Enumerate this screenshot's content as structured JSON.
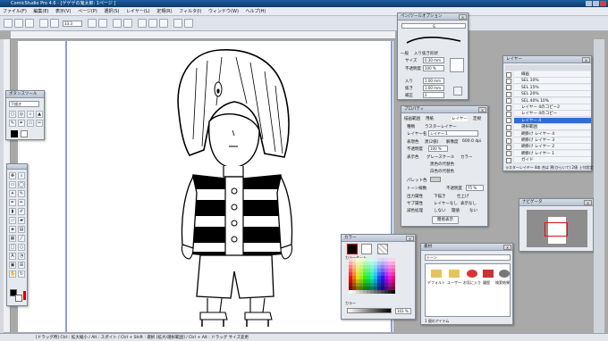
{
  "app": {
    "title": "ComicStudio Pro 4.6 - [ゲゲゲの鬼太郎: 1ページ ]"
  },
  "menu": [
    "ファイル(F)",
    "編集(E)",
    "表示(V)",
    "ページ(P)",
    "選択(S)",
    "レイヤー(L)",
    "定規(R)",
    "フィルタ(I)",
    "ウィンドウ(W)",
    "ヘルプ(H)"
  ],
  "toolbar": {
    "zoom": "33.3"
  },
  "subtool": {
    "title": "ペン/ツールオプション",
    "pen_name": "G",
    "tabs": [
      "一般",
      "入り抜き",
      "形状"
    ],
    "size_label": "サイズ",
    "size": "0.30 mm",
    "opacity_label": "不透明度",
    "opacity": "100 %",
    "in_label": "入り",
    "in_val": "1.00 mm",
    "out_label": "抜き",
    "out_val": "1.00 mm",
    "correction_label": "補正",
    "correction_val": "2"
  },
  "layer_panel": {
    "title": "レイヤー",
    "items": [
      "線画",
      "SEL 10%",
      "SEL 15%",
      "SEL 20%",
      "SEL 40% 10%",
      "レイヤー 4のコピー2",
      "レイヤー 4のコピー",
      "レイヤー 4",
      "選択範囲",
      "網掛け レイヤー 4",
      "網掛け レイヤー 3",
      "網掛け レイヤー 2",
      "網掛け レイヤー 1",
      "ガイド"
    ],
    "selected_index": 7,
    "footer": "ラスターレイヤー 8本 合は 黒(ひらいて) 2値 上付設定"
  },
  "property_panel": {
    "title": "プロパティ",
    "tabs": [
      "描画範囲",
      "用紙",
      "レイヤー",
      "定規"
    ],
    "kind_label": "種類",
    "kind": "ラスターレイヤー",
    "name_label": "レイヤー名",
    "name": "レイヤー 1",
    "depth_label": "表現色",
    "depth": "黒(2値)",
    "resolution_label": "解像度",
    "resolution": "600.0 dpi",
    "opacity_label": "不透明度",
    "opacity": "100 %",
    "mode_label": "表示色",
    "mode_options": [
      "グレースケール",
      "カラー",
      "黒色の代替色",
      "白色の代替色"
    ],
    "palette_label": "パレット色",
    "tone_label": "トーン線数",
    "tone_opacity_label": "不透明度",
    "tone_opacity": "75 %",
    "output_label": "出力属性",
    "output_options": [
      "下描き",
      "仕上げ"
    ],
    "sub_label": "サブ属性",
    "sub_options": [
      "レイヤーなし",
      "表示なし"
    ],
    "reduce_label": "減色処理",
    "reduce_options": [
      "しない",
      "閾値",
      "ない"
    ],
    "button": "簡易表示"
  },
  "tool_panel": {
    "title": "ボタンスツール",
    "label": "下描き"
  },
  "color_panel": {
    "title": "カラー",
    "section": "カラーセット",
    "section2": "カラー",
    "value": "101 %"
  },
  "material_panel": {
    "title": "素材",
    "path": "トーン",
    "folders": [
      "デフォルト",
      "ユーザー",
      "お気に入り",
      "履歴",
      "検索結果"
    ],
    "footer": "1 個のアイテム"
  },
  "navigator": {
    "title": "ナビゲータ"
  },
  "status": {
    "text": "[ドラッグ時] Ctrl : 拡大縮小 / Alt : スポイト / Ctrl + Shift : 選択 [拡大/選択範囲] / Ctrl + Alt : ドラッグ サイズ変更"
  },
  "colors": {
    "selected": "#2f6fd0",
    "guide": "#3a5bd9",
    "nav_frame": "#d11"
  }
}
